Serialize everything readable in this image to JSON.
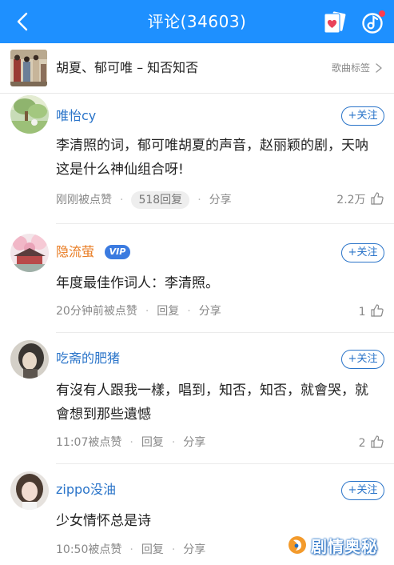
{
  "header": {
    "title": "评论(34603)"
  },
  "song": {
    "title": "胡夏、郁可唯 – 知否知否",
    "tag_label": "歌曲标签"
  },
  "comments": [
    {
      "username": "唯怡cy",
      "vip": false,
      "follow_label": "+关注",
      "text": "李清照的词，郁可唯胡夏的声音，赵丽颖的剧，天呐这是什么神仙组合呀!",
      "time": "刚刚被点赞",
      "reply_label": "518回复",
      "share_label": "分享",
      "likes": "2.2万"
    },
    {
      "username": "隐流萤",
      "vip": true,
      "vip_label": "VIP",
      "follow_label": "+关注",
      "text": "年度最佳作词人：李清照。",
      "time": "20分钟前被点赞",
      "reply_label": "回复",
      "share_label": "分享",
      "likes": "1"
    },
    {
      "username": "吃斋的肥猪",
      "vip": false,
      "follow_label": "+关注",
      "text": "有沒有人跟我一樣，唱到，知否，知否，就會哭，就會想到那些遺憾",
      "time": "11:07被点赞",
      "reply_label": "回复",
      "share_label": "分享",
      "likes": "2"
    },
    {
      "username": "zippo没油",
      "vip": false,
      "follow_label": "+关注",
      "text": "少女情怀总是诗",
      "time": "10:50被点赞",
      "reply_label": "回复",
      "share_label": "分享",
      "likes": ""
    }
  ],
  "watermark": {
    "text": "剧情奥秘"
  },
  "colors": {
    "header_bg": "#1e90ff",
    "username": "#2a74c9",
    "vip_username": "#e8791e",
    "vip_badge": "#3b7be0"
  }
}
